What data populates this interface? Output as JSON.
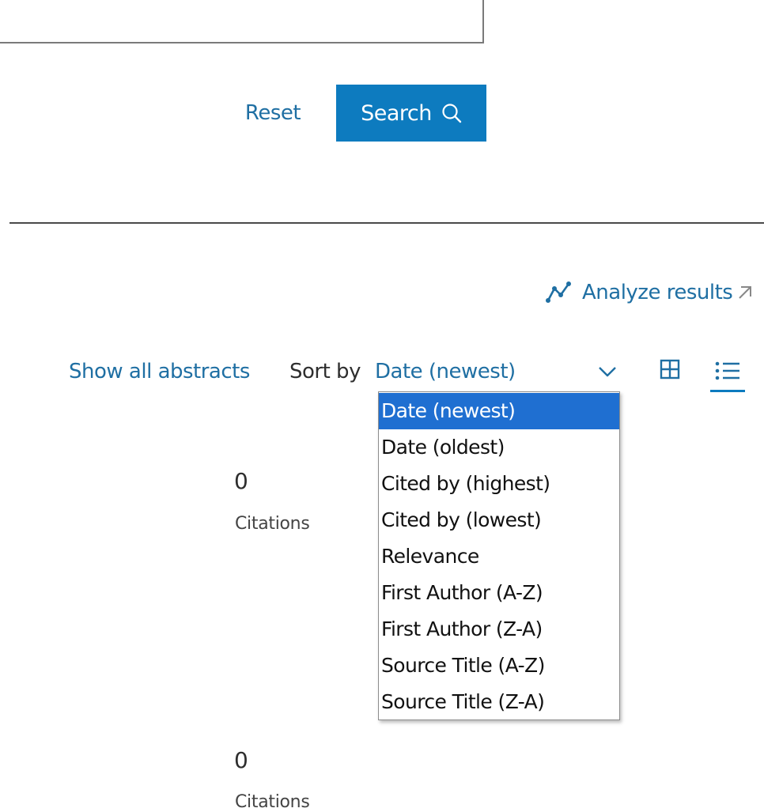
{
  "search": {
    "reset_label": "Reset",
    "search_label": "Search",
    "search_icon": "magnifier-icon"
  },
  "toolbar": {
    "analyze_label": "Analyze results",
    "analyze_icon": "trend-line-icon",
    "external_icon": "arrow-up-right-icon",
    "show_abstracts_label": "Show all abstracts",
    "sort_label": "Sort by",
    "sort_value": "Date (newest)",
    "chevron_icon": "chevron-down-icon",
    "grid_view_icon": "grid-view-icon",
    "list_view_icon": "list-view-icon"
  },
  "sort_options": [
    "Date (newest)",
    "Date (oldest)",
    "Cited by (highest)",
    "Cited by (lowest)",
    "Relevance",
    "First Author (A-Z)",
    "First Author (Z-A)",
    "Source Title (A-Z)",
    "Source Title (Z-A)"
  ],
  "results": [
    {
      "citations": "0",
      "citations_label": "Citations"
    },
    {
      "citations": "0",
      "citations_label": "Citations"
    }
  ],
  "colors": {
    "link": "#1f6fa3",
    "primary_button": "#0d7bbf",
    "selected_option": "#1f6fd1"
  }
}
